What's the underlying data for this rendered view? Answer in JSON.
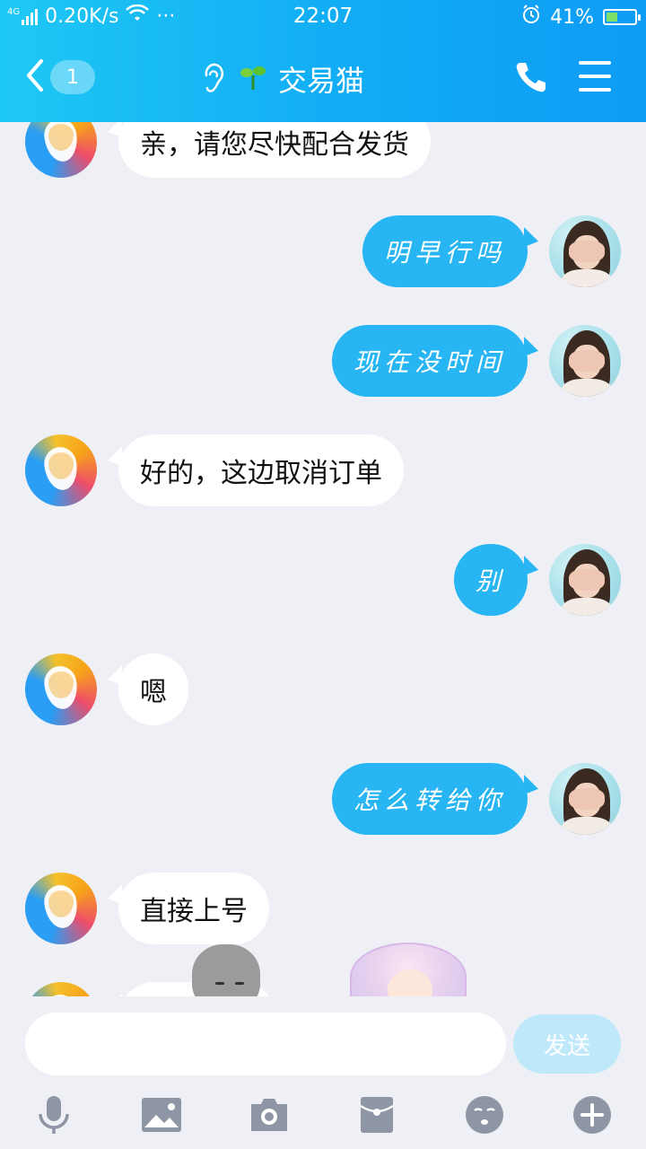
{
  "status_bar": {
    "network": "4G",
    "speed": "0.20K/s",
    "dots": "···",
    "time": "22:07",
    "battery": "41%",
    "battery_level": 0.41
  },
  "header": {
    "unread_count": "1",
    "title": "交易猫"
  },
  "messages": [
    {
      "side": "left",
      "text": "亲，请您尽快配合发货"
    },
    {
      "side": "right",
      "text": "明早行吗"
    },
    {
      "side": "right",
      "text": "现在没时间"
    },
    {
      "side": "left",
      "text": "好的，这边取消订单"
    },
    {
      "side": "right",
      "text": "别"
    },
    {
      "side": "left",
      "text": "嗯"
    },
    {
      "side": "right",
      "text": "怎么转给你"
    },
    {
      "side": "left",
      "text": "直接上号"
    }
  ],
  "input": {
    "value": "",
    "placeholder": "",
    "send_label": "发送"
  },
  "toolbar": {
    "items": [
      "microphone-icon",
      "image-icon",
      "camera-icon",
      "red-packet-icon",
      "emoji-icon",
      "plus-icon"
    ]
  },
  "colors": {
    "header_start": "#1ec8f4",
    "header_end": "#0e9cf5",
    "outgoing_bubble": "#27b5f3",
    "incoming_bubble": "#ffffff",
    "background": "#eef0f6",
    "send_button": "#bfe9fb"
  }
}
